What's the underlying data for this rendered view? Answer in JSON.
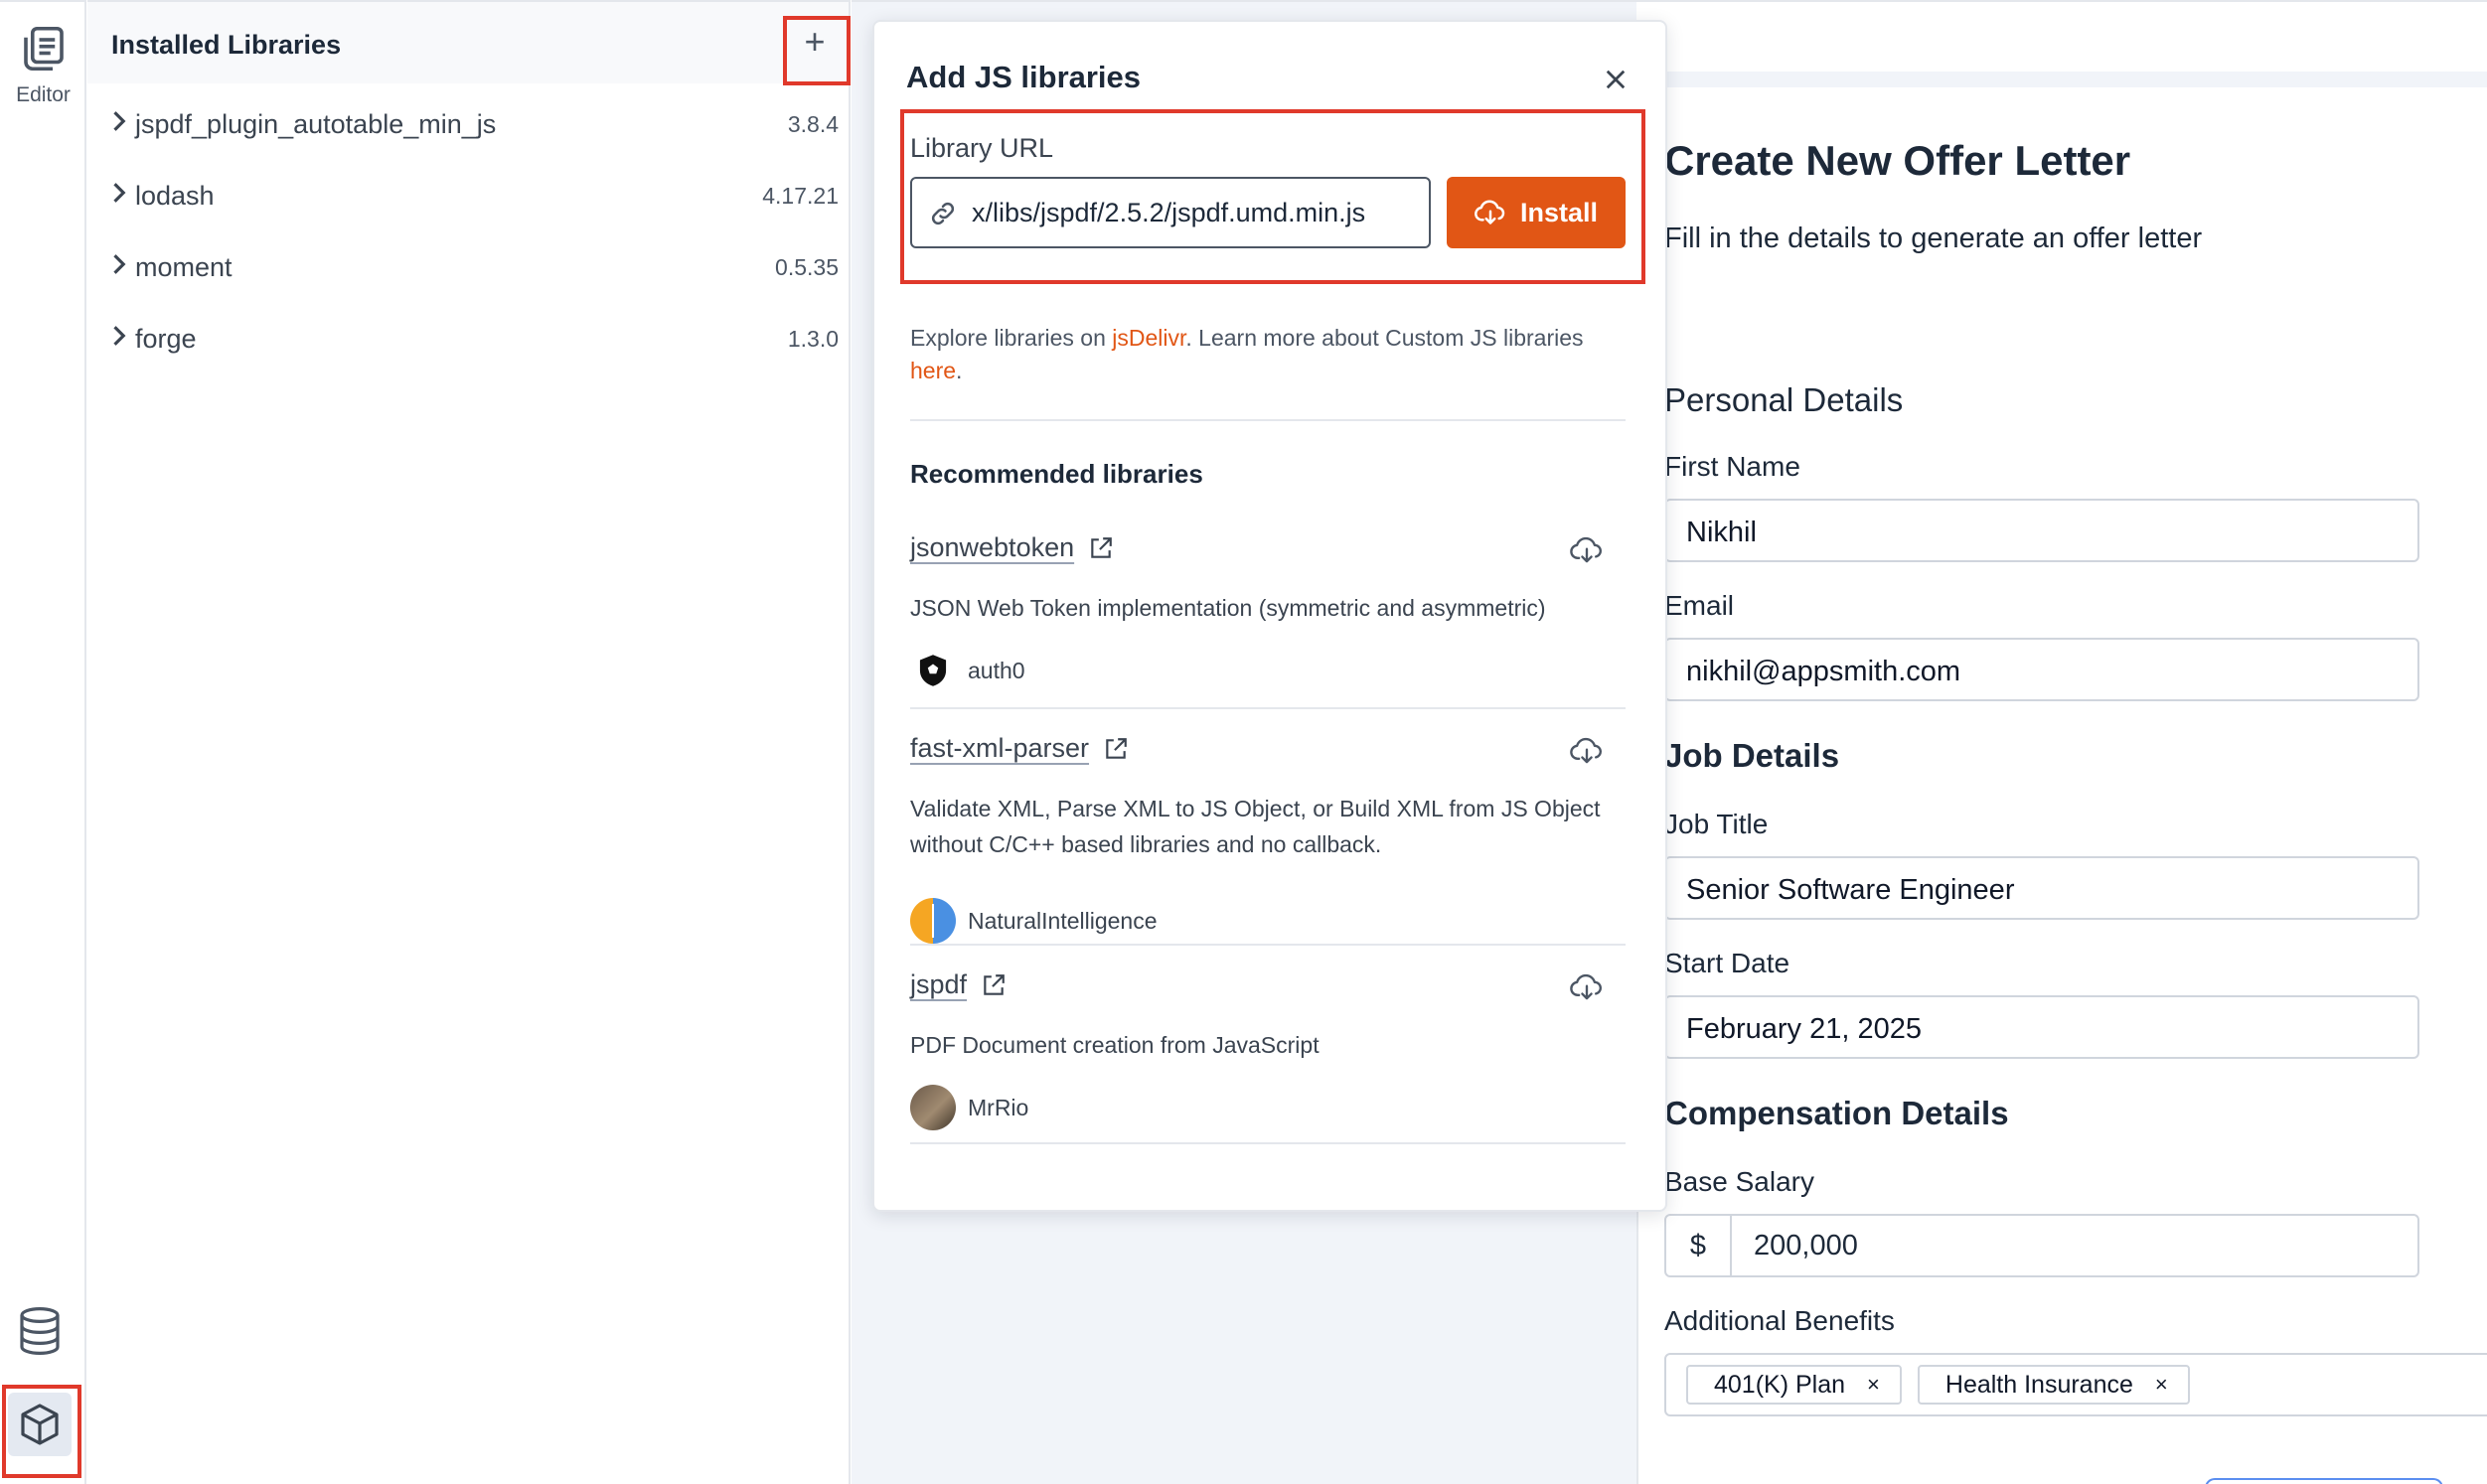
{
  "rail": {
    "editor_label": "Editor"
  },
  "libraries_panel": {
    "title": "Installed Libraries",
    "add_button": "+",
    "items": [
      {
        "name": "jspdf_plugin_autotable_min_js",
        "version": "3.8.4"
      },
      {
        "name": "lodash",
        "version": "4.17.21"
      },
      {
        "name": "moment",
        "version": "0.5.35"
      },
      {
        "name": "forge",
        "version": "1.3.0"
      }
    ]
  },
  "modal": {
    "title": "Add JS libraries",
    "url_label": "Library URL",
    "url_value": "x/libs/jspdf/2.5.2/jspdf.umd.min.js",
    "install_label": "Install",
    "explore_prefix": "Explore libraries on ",
    "explore_link": "jsDelivr",
    "explore_middle": ". Learn more about Custom JS libraries ",
    "explore_here": "here",
    "explore_suffix": ".",
    "recommended_title": "Recommended libraries",
    "recommended": [
      {
        "name": "jsonwebtoken",
        "description": "JSON Web Token implementation (symmetric and asymmetric)",
        "author": "auth0"
      },
      {
        "name": "fast-xml-parser",
        "description": "Validate XML, Parse XML to JS Object, or Build XML from JS Object without C/C++ based libraries and no callback.",
        "author": "NaturalIntelligence"
      },
      {
        "name": "jspdf",
        "description": "PDF Document creation from JavaScript",
        "author": "MrRio"
      }
    ]
  },
  "form": {
    "title": "Create New Offer Letter",
    "subtitle": "Fill in the details to generate an offer letter",
    "personal_section": "Personal Details",
    "first_name_label": "First Name",
    "first_name_value": "Nikhil",
    "email_label": "Email",
    "email_value": "nikhil@appsmith.com",
    "job_section": "Job Details",
    "job_title_label": "Job Title",
    "job_title_value": "Senior Software Engineer",
    "start_date_label": "Start Date",
    "start_date_value": "February 21, 2025",
    "comp_section": "Compensation Details",
    "base_salary_label": "Base Salary",
    "currency": "$",
    "base_salary_value": "200,000",
    "benefits_label": "Additional Benefits",
    "benefits": [
      "401(K) Plan",
      "Health Insurance"
    ],
    "chip_remove": "×"
  },
  "colors": {
    "accent": "#e15615",
    "highlight": "#e0392b",
    "canvas_bg": "#f1f4f9"
  }
}
